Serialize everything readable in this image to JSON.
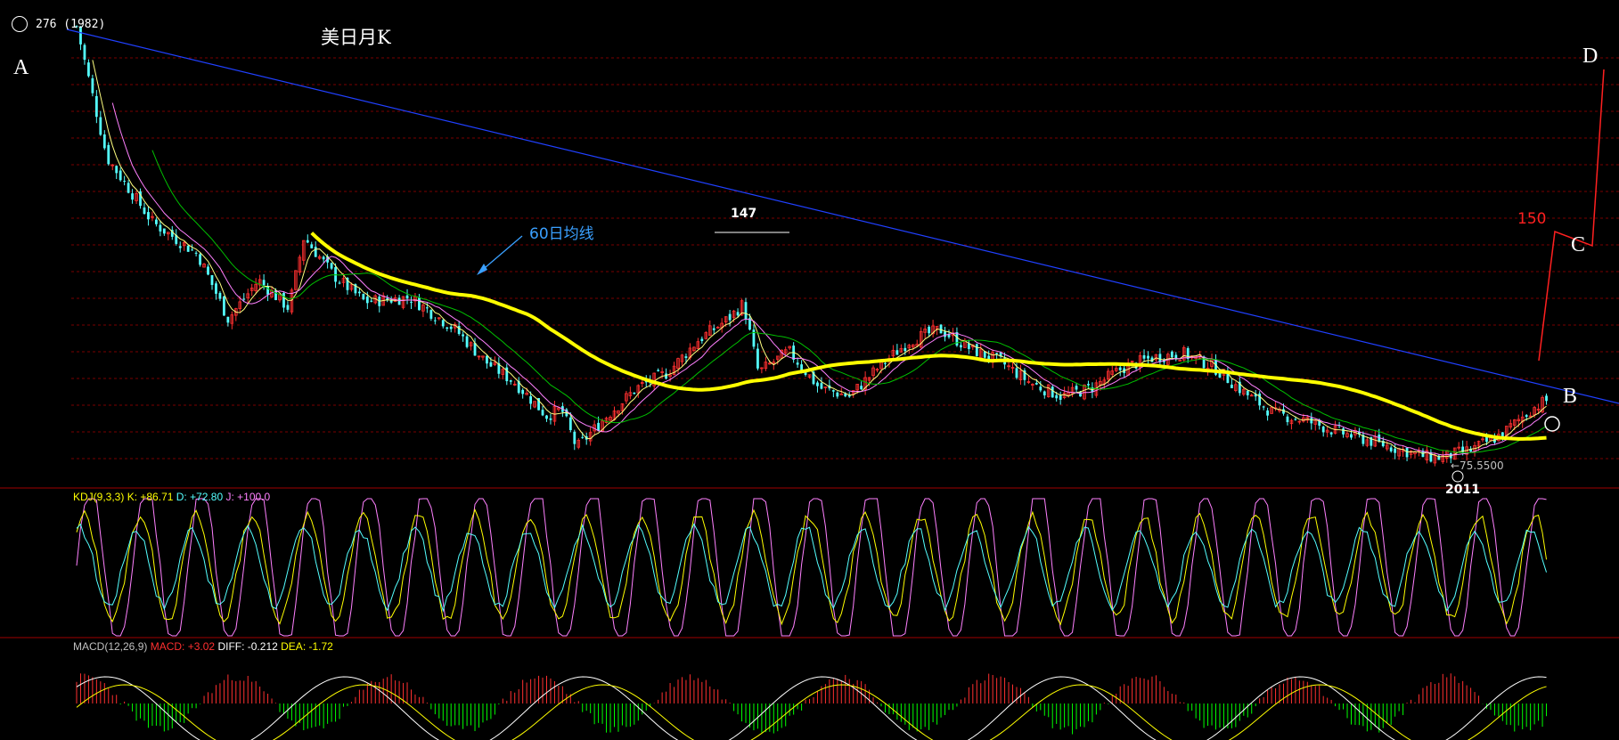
{
  "header": {
    "circle_label": "276 (1982)",
    "title": "美日月K"
  },
  "markers": {
    "A": "A",
    "B": "B",
    "C": "C",
    "D": "D",
    "peak_147": "147",
    "target_150": "150",
    "low_value": "←75.5500",
    "year_2011": "2011",
    "ma60_label": "60日均线"
  },
  "kdj_label": {
    "name": "KDJ(9,3,3)",
    "k": "K: +86.71",
    "d": "D: +72.80",
    "j": "J: +100.0"
  },
  "macd_label": {
    "name": "MACD(12,26,9)",
    "macd": "MACD: +3.02",
    "diff": "DIFF: -0.212",
    "dea": "DEA: -1.72"
  },
  "colors": {
    "background": "#000000",
    "bull": "#ff3030",
    "bear": "#54ffff",
    "ma_thick": "#ffff00",
    "trendline": "#2040ff",
    "projection": "#ff2020",
    "kdj_k": "#ffffff",
    "kdj_d": "#ffff00",
    "kdj_j": "#ff80ff",
    "macd_pos": "#ff3030",
    "macd_neg": "#00ff00",
    "grid": "#7a0000",
    "annotation_blue": "#3aa0ff"
  },
  "chart_data": {
    "type": "candlestick",
    "title": "美日月K",
    "period": "monthly",
    "x_range": [
      "1982",
      "2013"
    ],
    "y_range_approx": [
      73,
      280
    ],
    "points": [
      {
        "label": "1982 start",
        "price": 276
      },
      {
        "label": "1985 range",
        "price": 240
      },
      {
        "label": "1990 peak",
        "price": 160
      },
      {
        "label": "1995 low",
        "price": 80
      },
      {
        "label": "1998 peak",
        "price": 147
      },
      {
        "label": "2002 peak",
        "price": 135
      },
      {
        "label": "2007 peak",
        "price": 124
      },
      {
        "label": "2011 low",
        "price": 75.55
      },
      {
        "label": "latest",
        "price": 102
      }
    ],
    "annotations": [
      "A",
      "B",
      "C",
      "D",
      "150",
      "147",
      "2011",
      "←75.5500",
      "60日均线"
    ],
    "indicators": {
      "kdj": {
        "k": 86.71,
        "d": 72.8,
        "j": 100.0
      },
      "macd": {
        "macd": 3.02,
        "diff": -0.212,
        "dea": -1.72
      }
    }
  }
}
